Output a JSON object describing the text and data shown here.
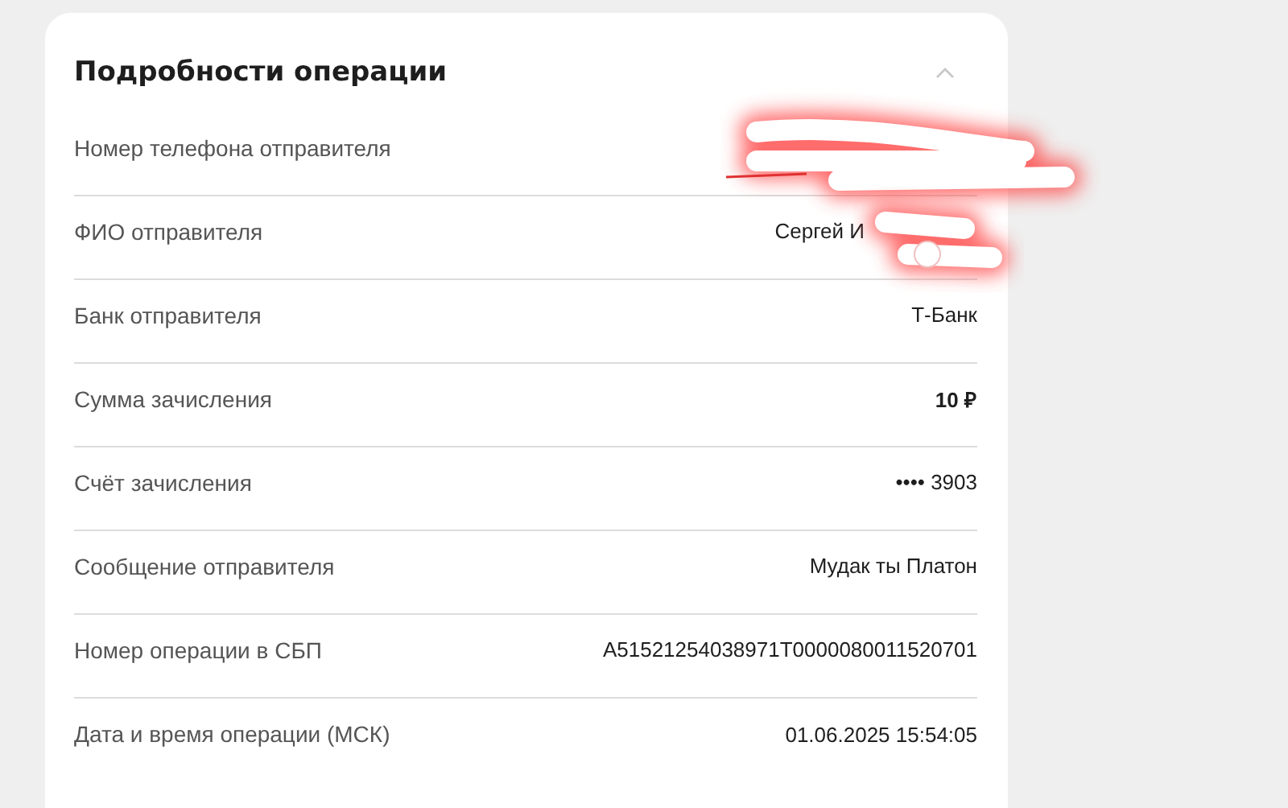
{
  "title": "Подробности операции",
  "section_expanded": true,
  "rows": [
    {
      "label": "Номер телефона отправителя",
      "redacted": true
    },
    {
      "label": "ФИО отправителя",
      "value": "Сергей И",
      "redacted": true
    },
    {
      "label": "Банк отправителя",
      "value": "Т-Банк"
    },
    {
      "label": "Сумма зачисления",
      "value": "10 ₽",
      "bold": true
    },
    {
      "label": "Счёт зачисления",
      "value": "•••• 3903",
      "bold": false
    },
    {
      "label": "Сообщение отправителя",
      "value": "Мудак ты Платон",
      "bold": false
    },
    {
      "label": "Номер операции в СБП",
      "value": "A51521254038971T0000080011520701",
      "bold": false
    },
    {
      "label": "Дата и время операции (МСК)",
      "value": "01.06.2025 15:54:05",
      "bold": false
    }
  ]
}
